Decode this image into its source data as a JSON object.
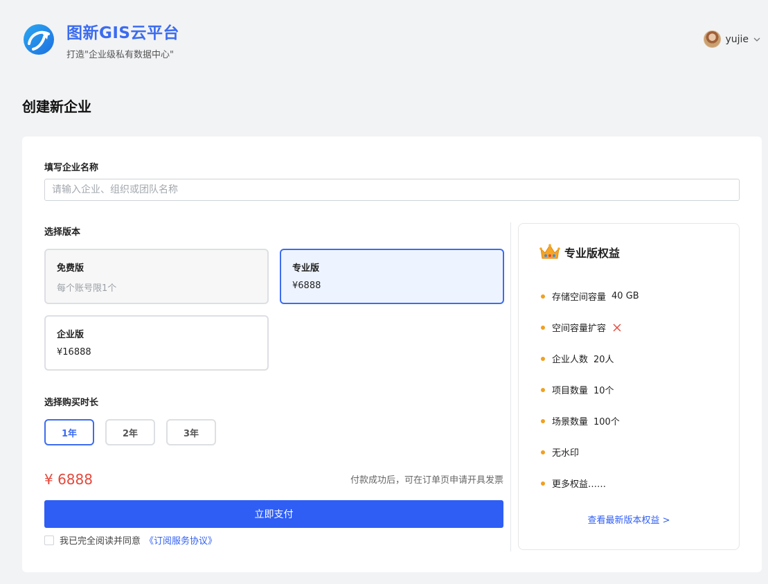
{
  "header": {
    "title": "图新GIS云平台",
    "subtitle": "打造\"企业级私有数据中心\"",
    "user_name": "yujie"
  },
  "page_title": "创建新企业",
  "form": {
    "name_label": "填写企业名称",
    "name_placeholder": "请输入企业、组织或团队名称",
    "name_value": "",
    "plan_label": "选择版本",
    "plans": [
      {
        "name": "免费版",
        "price": "每个账号限1个"
      },
      {
        "name": "专业版",
        "price": "¥6888"
      },
      {
        "name": "企业版",
        "price": "¥16888"
      }
    ],
    "selected_plan": "专业版",
    "duration_label": "选择购买时长",
    "durations": [
      "1年",
      "2年",
      "3年"
    ],
    "selected_duration": "1年",
    "price": "¥ 6888",
    "invoice_note": "付款成功后，可在订单页申请开具发票",
    "pay_button": "立即支付",
    "agree_text": "我已完全阅读并同意",
    "agree_link": "《订阅服务协议》",
    "agree_checked": false
  },
  "benefits": {
    "title": "专业版权益",
    "items": [
      {
        "label": "存储空间容量",
        "value": "40 GB"
      },
      {
        "label": "空间容量扩容",
        "value": ""
      },
      {
        "label": "企业人数",
        "value": "20人"
      },
      {
        "label": "项目数量",
        "value": "10个"
      },
      {
        "label": "场景数量",
        "value": "100个"
      },
      {
        "label": "无水印",
        "value": ""
      },
      {
        "label": "更多权益……",
        "value": ""
      }
    ],
    "link": "查看最新版本权益 >"
  },
  "colors": {
    "primary": "#2f5ef5",
    "brand": "#3b6cf0",
    "price": "#e5473a",
    "bullet": "#f0a020"
  },
  "icons": {
    "logo": "logo-icon",
    "user_avatar": "avatar",
    "dropdown": "chevron-down-icon",
    "crown": "crown-icon",
    "unavailable": "close-icon"
  }
}
